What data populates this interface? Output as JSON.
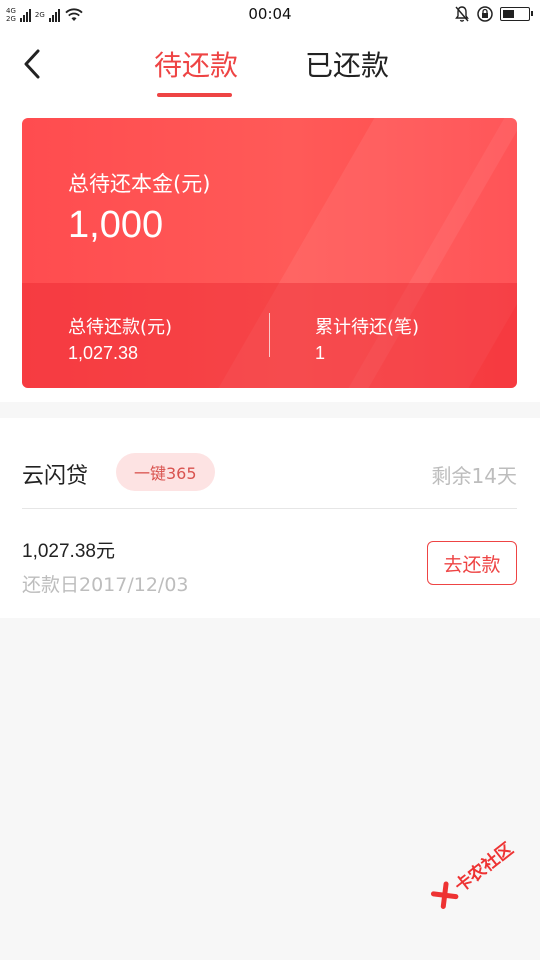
{
  "status_bar": {
    "network_labels": [
      "4G",
      "2G",
      "2G"
    ],
    "time": "00:04",
    "icons": [
      "wifi-icon",
      "mute-bell-icon",
      "rotation-lock-icon",
      "battery-icon"
    ]
  },
  "header": {
    "tabs": [
      {
        "label": "待还款",
        "active": true
      },
      {
        "label": "已还款",
        "active": false
      }
    ],
    "back_icon": "chevron-left-icon"
  },
  "summary": {
    "principal_label": "总待还本金(元)",
    "principal_value": "1,000",
    "total_due_label": "总待还款(元)",
    "total_due_value": "1,027.38",
    "count_label": "累计待还(笔)",
    "count_value": "1"
  },
  "loan": {
    "name": "云闪贷",
    "badge": "一键365",
    "remaining": "剩余14天",
    "amount": "1,027.38元",
    "due_date": "还款日2017/12/03",
    "repay_label": "去还款"
  },
  "watermark": {
    "text": "卡农社区"
  },
  "colors": {
    "accent": "#ee4444",
    "card": "#ff4c4f",
    "muted": "#bdbdbd",
    "badge_bg": "#fde3e3"
  }
}
